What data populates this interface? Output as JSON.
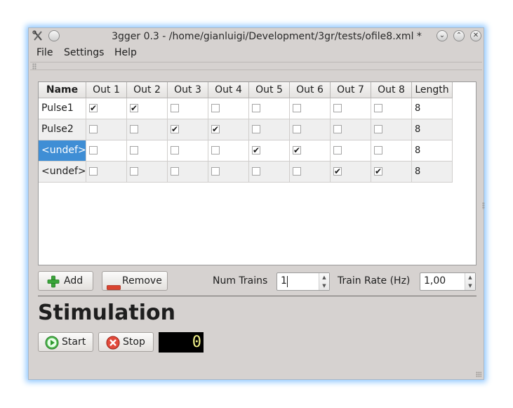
{
  "window": {
    "title": "3gger 0.3 - /home/gianluigi/Development/3gr/tests/ofile8.xml *",
    "app_icon": "tools-icon",
    "controls": [
      "minimize-icon",
      "maximize-icon",
      "close-icon"
    ]
  },
  "menu": {
    "items": [
      {
        "label": "File"
      },
      {
        "label": "Settings"
      },
      {
        "label": "Help"
      }
    ]
  },
  "table": {
    "headers": [
      "Name",
      "Out 1",
      "Out 2",
      "Out 3",
      "Out 4",
      "Out 5",
      "Out 6",
      "Out 7",
      "Out 8",
      "Length"
    ],
    "rows": [
      {
        "name": "Pulse1",
        "outs": [
          true,
          true,
          false,
          false,
          false,
          false,
          false,
          false
        ],
        "length": "8",
        "selected": false
      },
      {
        "name": "Pulse2",
        "outs": [
          false,
          false,
          true,
          true,
          false,
          false,
          false,
          false
        ],
        "length": "8",
        "selected": false
      },
      {
        "name": "<undef>",
        "outs": [
          false,
          false,
          false,
          false,
          true,
          true,
          false,
          false
        ],
        "length": "8",
        "selected": true
      },
      {
        "name": "<undef>",
        "outs": [
          false,
          false,
          false,
          false,
          false,
          false,
          true,
          true
        ],
        "length": "8",
        "selected": false
      }
    ],
    "check_glyph": "✔"
  },
  "controls": {
    "add_label": "Add",
    "remove_label": "Remove",
    "num_trains_label": "Num Trains",
    "num_trains_value": "1",
    "train_rate_label": "Train Rate (Hz)",
    "train_rate_value": "1,00"
  },
  "stimulation": {
    "title": "Stimulation",
    "start_label": "Start",
    "stop_label": "Stop",
    "counter": "0"
  },
  "colors": {
    "selection": "#3f8ed5",
    "window_bg": "#d6d2d0",
    "add_icon": "#3aa53a",
    "remove_icon": "#d9432f",
    "lcd_text": "#f2f28a"
  }
}
